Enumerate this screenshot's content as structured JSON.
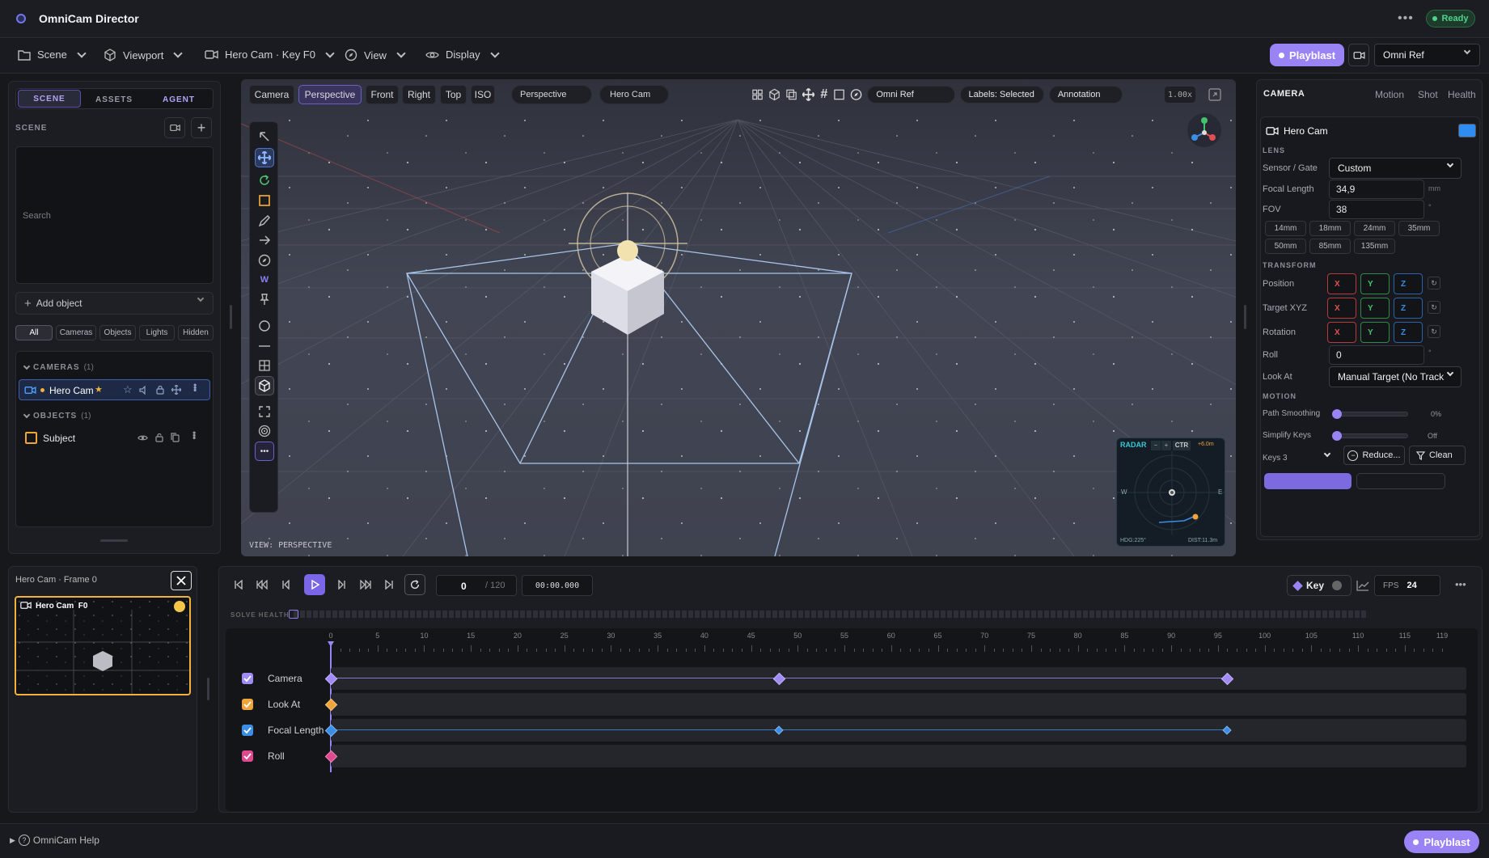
{
  "app": {
    "title": "OmniCam Director",
    "status": "Ready"
  },
  "menus": {
    "scene": "Scene",
    "viewport": "Viewport",
    "camera_key": "Hero Cam · Key F0",
    "view": "View",
    "display": "Display",
    "playblast": "Playblast",
    "reference": "Omni Ref"
  },
  "left": {
    "tabs": [
      "SCENE",
      "ASSETS",
      "AGENT"
    ],
    "section_title": "SCENE",
    "search_placeholder": "Search",
    "add_object": "Add object",
    "filters": [
      "All",
      "Cameras",
      "Objects",
      "Lights",
      "Hidden"
    ],
    "cameras_header": "CAMERAS",
    "cameras_count": "(1)",
    "camera_item": "Hero Cam",
    "objects_header": "OBJECTS",
    "objects_count": "(1)",
    "object_item": "Subject"
  },
  "viewport": {
    "tabs": [
      "Camera",
      "Perspective",
      "Front",
      "Right",
      "Top",
      "ISO"
    ],
    "active_tab": "Perspective",
    "mode_select": "Perspective",
    "camera_select": "Hero Cam",
    "ref_select": "Omni Ref",
    "labels_select": "Labels: Selected",
    "annotation_select": "Annotation",
    "zoom": "1.00x",
    "view_label": "VIEW: PERSPECTIVE",
    "radar": {
      "title": "RADAR",
      "minus": "−",
      "plus": "+",
      "ctr": "CTR",
      "height": "+6.0m",
      "w": "W",
      "e": "E",
      "hdg": "HDG:225°",
      "dist": "DIST:11.3m"
    }
  },
  "right": {
    "title": "CAMERA",
    "tabs": [
      "Motion",
      "Shot",
      "Health"
    ],
    "camera_name": "Hero Cam",
    "camera_color": "#2f8cf0",
    "lens_header": "LENS",
    "sensor_label": "Sensor / Gate",
    "sensor_value": "Custom",
    "focal_label": "Focal Length",
    "focal_value": "34,9",
    "focal_unit": "mm",
    "fov_label": "FOV",
    "fov_value": "38",
    "fov_unit": "°",
    "lens_presets": [
      "14mm",
      "18mm",
      "24mm",
      "35mm",
      "50mm",
      "85mm",
      "135mm"
    ],
    "transform_header": "TRANSFORM",
    "position_label": "Position",
    "target_label": "Target XYZ",
    "rotation_label": "Rotation",
    "axis": [
      "X",
      "Y",
      "Z"
    ],
    "roll_label": "Roll",
    "roll_value": "0",
    "roll_unit": "°",
    "lookat_label": "Look At",
    "lookat_value": "Manual Target (No Track",
    "motion_header": "MOTION",
    "smoothing_label": "Path Smoothing",
    "smoothing_value": "0%",
    "smoothing_level": 0,
    "simplify_label": "Simplify Keys",
    "simplify_value": "Off",
    "simplify_level": 0,
    "keys_label": "Keys 3",
    "reduce_label": "Reduce...",
    "clean_label": "Clean"
  },
  "thumb": {
    "title": "Hero Cam · Frame 0",
    "card_label": "Hero Cam  F0"
  },
  "timeline": {
    "frame": "0",
    "total": "/ 120",
    "timecode": "00:00.000",
    "key_label": "Key",
    "fps_label": "FPS",
    "fps_value": "24",
    "solve_label": "SOLVE HEALTH",
    "ticks": [
      "0",
      "5",
      "10",
      "15",
      "20",
      "25",
      "30",
      "35",
      "40",
      "45",
      "50",
      "55",
      "60",
      "65",
      "70",
      "75",
      "80",
      "85",
      "90",
      "95",
      "100",
      "105",
      "110",
      "115",
      "119"
    ],
    "tracks": [
      {
        "name": "Camera",
        "color": "#a18bf7",
        "keys": [
          0,
          48,
          96
        ]
      },
      {
        "name": "Look At",
        "color": "#f0a53a",
        "keys": [
          0
        ]
      },
      {
        "name": "Focal Length",
        "color": "#3b8ee6",
        "keys": [
          0,
          48,
          96
        ]
      },
      {
        "name": "Roll",
        "color": "#e0488f",
        "keys": [
          0
        ]
      }
    ]
  },
  "footer": {
    "help": "OmniCam Help",
    "playblast": "Playblast"
  }
}
